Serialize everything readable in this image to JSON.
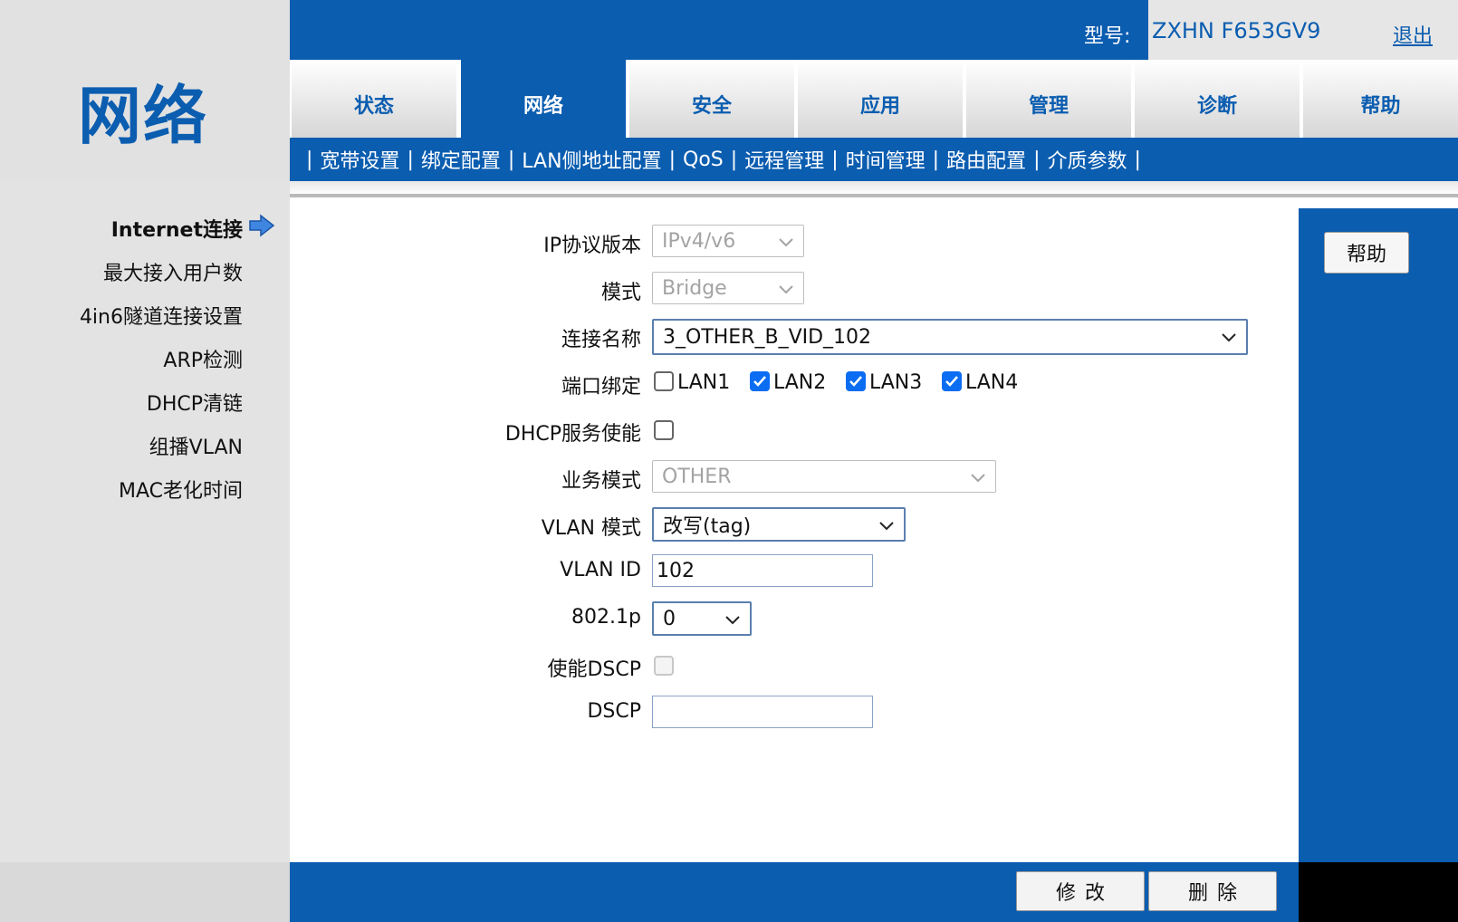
{
  "app": {
    "section_title": "网络",
    "model_label": "型号:",
    "model_value": "ZXHN F653GV9",
    "logout": "退出"
  },
  "tabs": [
    {
      "label": "状态",
      "active": false
    },
    {
      "label": "网络",
      "active": true
    },
    {
      "label": "安全",
      "active": false
    },
    {
      "label": "应用",
      "active": false
    },
    {
      "label": "管理",
      "active": false
    },
    {
      "label": "诊断",
      "active": false
    },
    {
      "label": "帮助",
      "active": false
    }
  ],
  "sub_nav": {
    "separator": "|",
    "items": [
      "宽带设置",
      "绑定配置",
      "LAN侧地址配置",
      "QoS",
      "远程管理",
      "时间管理",
      "路由配置",
      "介质参数"
    ]
  },
  "sidebar": {
    "items": [
      {
        "label": "Internet连接",
        "active": true
      },
      {
        "label": "最大接入用户数",
        "active": false
      },
      {
        "label": "4in6隧道连接设置",
        "active": false
      },
      {
        "label": "ARP检测",
        "active": false
      },
      {
        "label": "DHCP清链",
        "active": false
      },
      {
        "label": "组播VLAN",
        "active": false
      },
      {
        "label": "MAC老化时间",
        "active": false
      }
    ]
  },
  "form": {
    "ip_version": {
      "label": "IP协议版本",
      "value": "IPv4/v6"
    },
    "mode": {
      "label": "模式",
      "value": "Bridge"
    },
    "connection_name": {
      "label": "连接名称",
      "value": "3_OTHER_B_VID_102"
    },
    "port_binding": {
      "label": "端口绑定",
      "ports": [
        {
          "label": "LAN1",
          "checked": false
        },
        {
          "label": "LAN2",
          "checked": true
        },
        {
          "label": "LAN3",
          "checked": true
        },
        {
          "label": "LAN4",
          "checked": true
        }
      ]
    },
    "dhcp_service": {
      "label": "DHCP服务使能",
      "checked": false
    },
    "service_mode": {
      "label": "业务模式",
      "value": "OTHER"
    },
    "vlan_mode": {
      "label": "VLAN 模式",
      "value": "改写(tag)"
    },
    "vlan_id": {
      "label": "VLAN ID",
      "value": "102"
    },
    "dot1p": {
      "label": "802.1p",
      "value": "0"
    },
    "enable_dscp": {
      "label": "使能DSCP",
      "checked": false
    },
    "dscp": {
      "label": "DSCP",
      "value": ""
    }
  },
  "right_panel": {
    "help_button": "帮助"
  },
  "footer": {
    "modify_button": "修改",
    "delete_button": "删除"
  },
  "colors": {
    "brand_blue": "#0b5db0",
    "checkbox_blue": "#0b6df2"
  }
}
